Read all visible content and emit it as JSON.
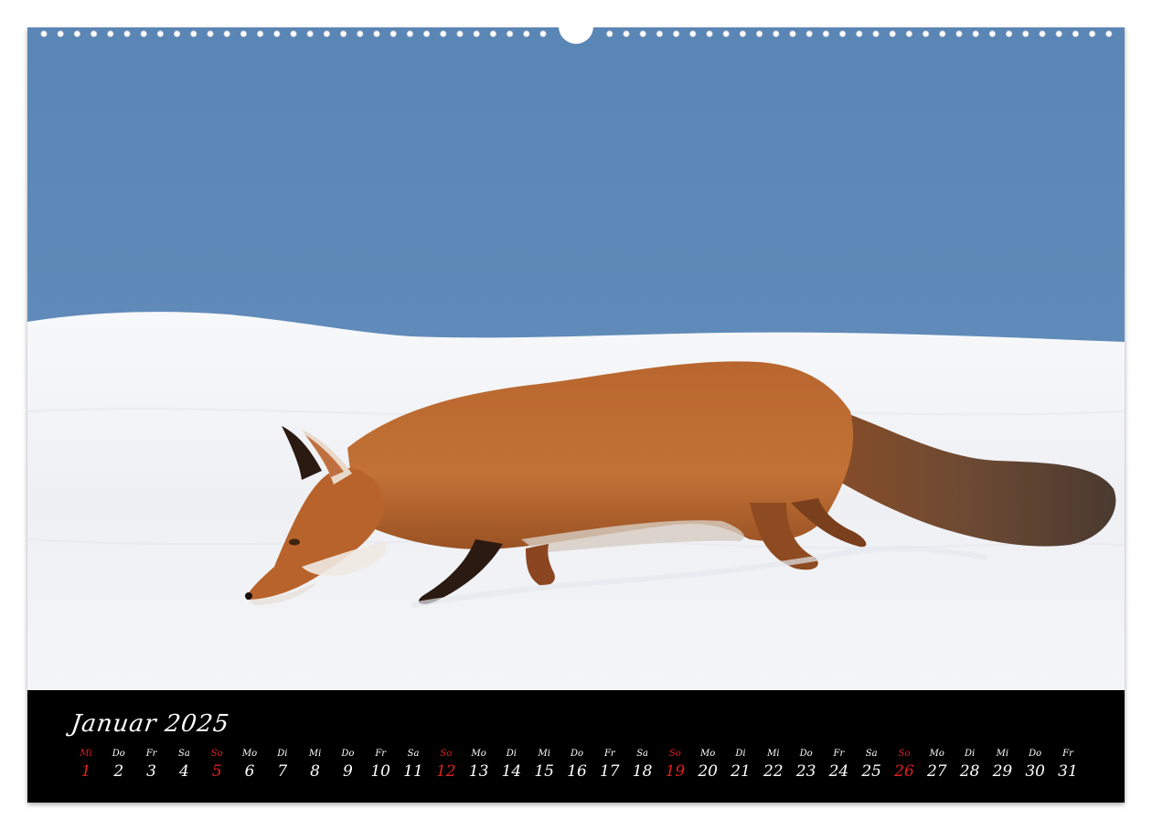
{
  "calendar": {
    "title": "Januar 2025",
    "sunday_color": "#e02020",
    "days": [
      {
        "wd": "Mi",
        "n": "1",
        "holiday": true
      },
      {
        "wd": "Do",
        "n": "2"
      },
      {
        "wd": "Fr",
        "n": "3"
      },
      {
        "wd": "Sa",
        "n": "4"
      },
      {
        "wd": "So",
        "n": "5",
        "holiday": true
      },
      {
        "wd": "Mo",
        "n": "6"
      },
      {
        "wd": "Di",
        "n": "7"
      },
      {
        "wd": "Mi",
        "n": "8"
      },
      {
        "wd": "Do",
        "n": "9"
      },
      {
        "wd": "Fr",
        "n": "10"
      },
      {
        "wd": "Sa",
        "n": "11"
      },
      {
        "wd": "So",
        "n": "12",
        "holiday": true
      },
      {
        "wd": "Mo",
        "n": "13"
      },
      {
        "wd": "Di",
        "n": "14"
      },
      {
        "wd": "Mi",
        "n": "15"
      },
      {
        "wd": "Do",
        "n": "16"
      },
      {
        "wd": "Fr",
        "n": "17"
      },
      {
        "wd": "Sa",
        "n": "18"
      },
      {
        "wd": "So",
        "n": "19",
        "holiday": true
      },
      {
        "wd": "Mo",
        "n": "20"
      },
      {
        "wd": "Di",
        "n": "21"
      },
      {
        "wd": "Mi",
        "n": "22"
      },
      {
        "wd": "Do",
        "n": "23"
      },
      {
        "wd": "Fr",
        "n": "24"
      },
      {
        "wd": "Sa",
        "n": "25"
      },
      {
        "wd": "So",
        "n": "26",
        "holiday": true
      },
      {
        "wd": "Mo",
        "n": "27"
      },
      {
        "wd": "Di",
        "n": "28"
      },
      {
        "wd": "Mi",
        "n": "29"
      },
      {
        "wd": "Do",
        "n": "30"
      },
      {
        "wd": "Fr",
        "n": "31"
      }
    ]
  },
  "photo": {
    "subject": "fox-in-snow",
    "sky_color": "#5b86b5",
    "snow_color": "#f2f4f7",
    "fur_color": "#b5622a"
  }
}
